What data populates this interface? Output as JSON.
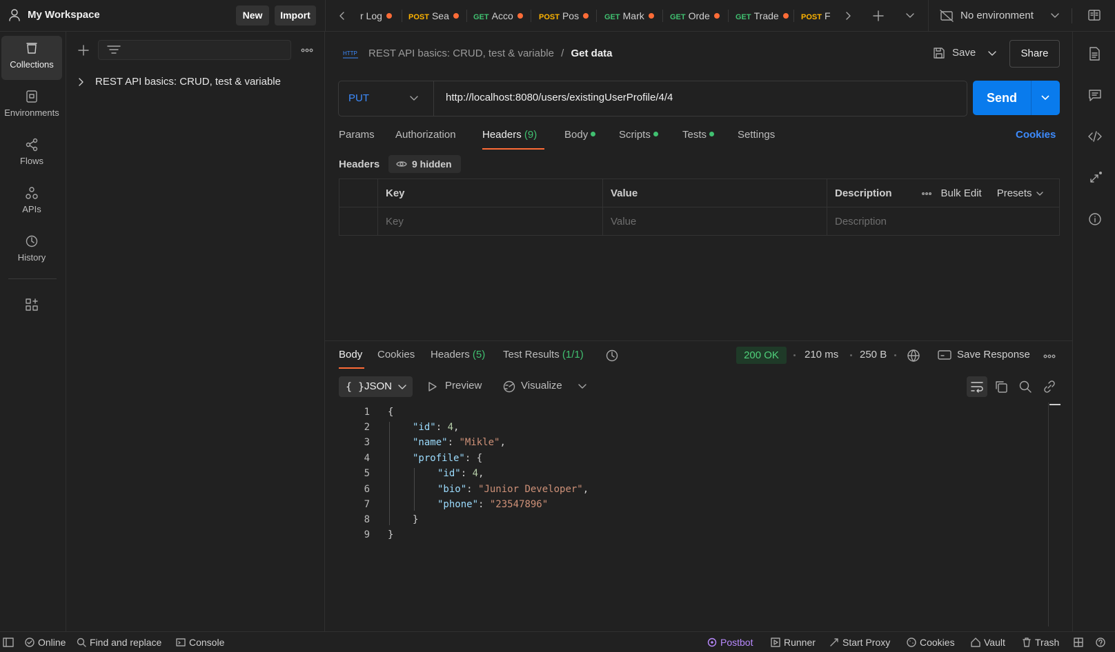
{
  "workspace": {
    "title": "My Workspace",
    "new_label": "New",
    "import_label": "Import"
  },
  "tabs": [
    {
      "method": "",
      "name": "r Log"
    },
    {
      "method": "POST",
      "name": "Sea"
    },
    {
      "method": "GET",
      "name": "Acco"
    },
    {
      "method": "POST",
      "name": "Pos"
    },
    {
      "method": "GET",
      "name": "Mark"
    },
    {
      "method": "GET",
      "name": "Orde"
    },
    {
      "method": "GET",
      "name": "Trade"
    },
    {
      "method": "POST",
      "name": "F"
    }
  ],
  "environment": {
    "label": "No environment"
  },
  "rail": [
    {
      "label": "Collections",
      "icon": "collections-icon"
    },
    {
      "label": "Environments",
      "icon": "environments-icon"
    },
    {
      "label": "Flows",
      "icon": "flows-icon"
    },
    {
      "label": "APIs",
      "icon": "apis-icon"
    },
    {
      "label": "History",
      "icon": "history-icon"
    }
  ],
  "sidebar": {
    "collection_name": "REST API basics: CRUD, test & variable"
  },
  "request": {
    "badge": "HTTP",
    "breadcrumb_parent": "REST API basics: CRUD, test & variable",
    "breadcrumb_sep": "/",
    "name": "Get data",
    "save_label": "Save",
    "share_label": "Share",
    "method": "PUT",
    "url": "http://localhost:8080/users/existingUserProfile/4/4",
    "send_label": "Send",
    "tabs": {
      "params": "Params",
      "authorization": "Authorization",
      "headers": "Headers",
      "headers_count": "(9)",
      "body": "Body",
      "scripts": "Scripts",
      "tests": "Tests",
      "settings": "Settings"
    },
    "cookies_link": "Cookies",
    "headers_title": "Headers",
    "hidden_label": "9 hidden",
    "table": {
      "key_header": "Key",
      "value_header": "Value",
      "description_header": "Description",
      "bulk_edit": "Bulk Edit",
      "presets": "Presets",
      "key_placeholder": "Key",
      "value_placeholder": "Value",
      "description_placeholder": "Description"
    }
  },
  "response": {
    "tabs": {
      "body": "Body",
      "cookies": "Cookies",
      "headers": "Headers",
      "headers_count": "(5)",
      "test_results": "Test Results",
      "test_results_count": "(1/1)"
    },
    "status": "200 OK",
    "time": "210 ms",
    "size": "250 B",
    "save_response": "Save Response",
    "format": "JSON",
    "preview": "Preview",
    "visualize": "Visualize",
    "body_lines": {
      "l1": "{",
      "l2_key": "\"id\"",
      "l2_val": "4",
      "l3_key": "\"name\"",
      "l3_val": "\"Mikle\"",
      "l4_key": "\"profile\"",
      "l4_open": "{",
      "l5_key": "\"id\"",
      "l5_val": "4",
      "l6_key": "\"bio\"",
      "l6_val": "\"Junior Developer\"",
      "l7_key": "\"phone\"",
      "l7_val": "\"23547896\"",
      "l8": "}",
      "l9": "}"
    },
    "line_numbers": [
      "1",
      "2",
      "3",
      "4",
      "5",
      "6",
      "7",
      "8",
      "9"
    ]
  },
  "statusbar": {
    "online": "Online",
    "find_replace": "Find and replace",
    "console": "Console",
    "postbot": "Postbot",
    "runner": "Runner",
    "start_proxy": "Start Proxy",
    "cookies": "Cookies",
    "vault": "Vault",
    "trash": "Trash"
  },
  "colors": {
    "accent_blue": "#097bed",
    "postbot_purple": "#b98aff",
    "status_green": "#40c070",
    "unsaved_dot": "#ff6c37",
    "post_method": "#ffb400",
    "get_method": "#40c070",
    "put_method": "#3d8bfd"
  }
}
